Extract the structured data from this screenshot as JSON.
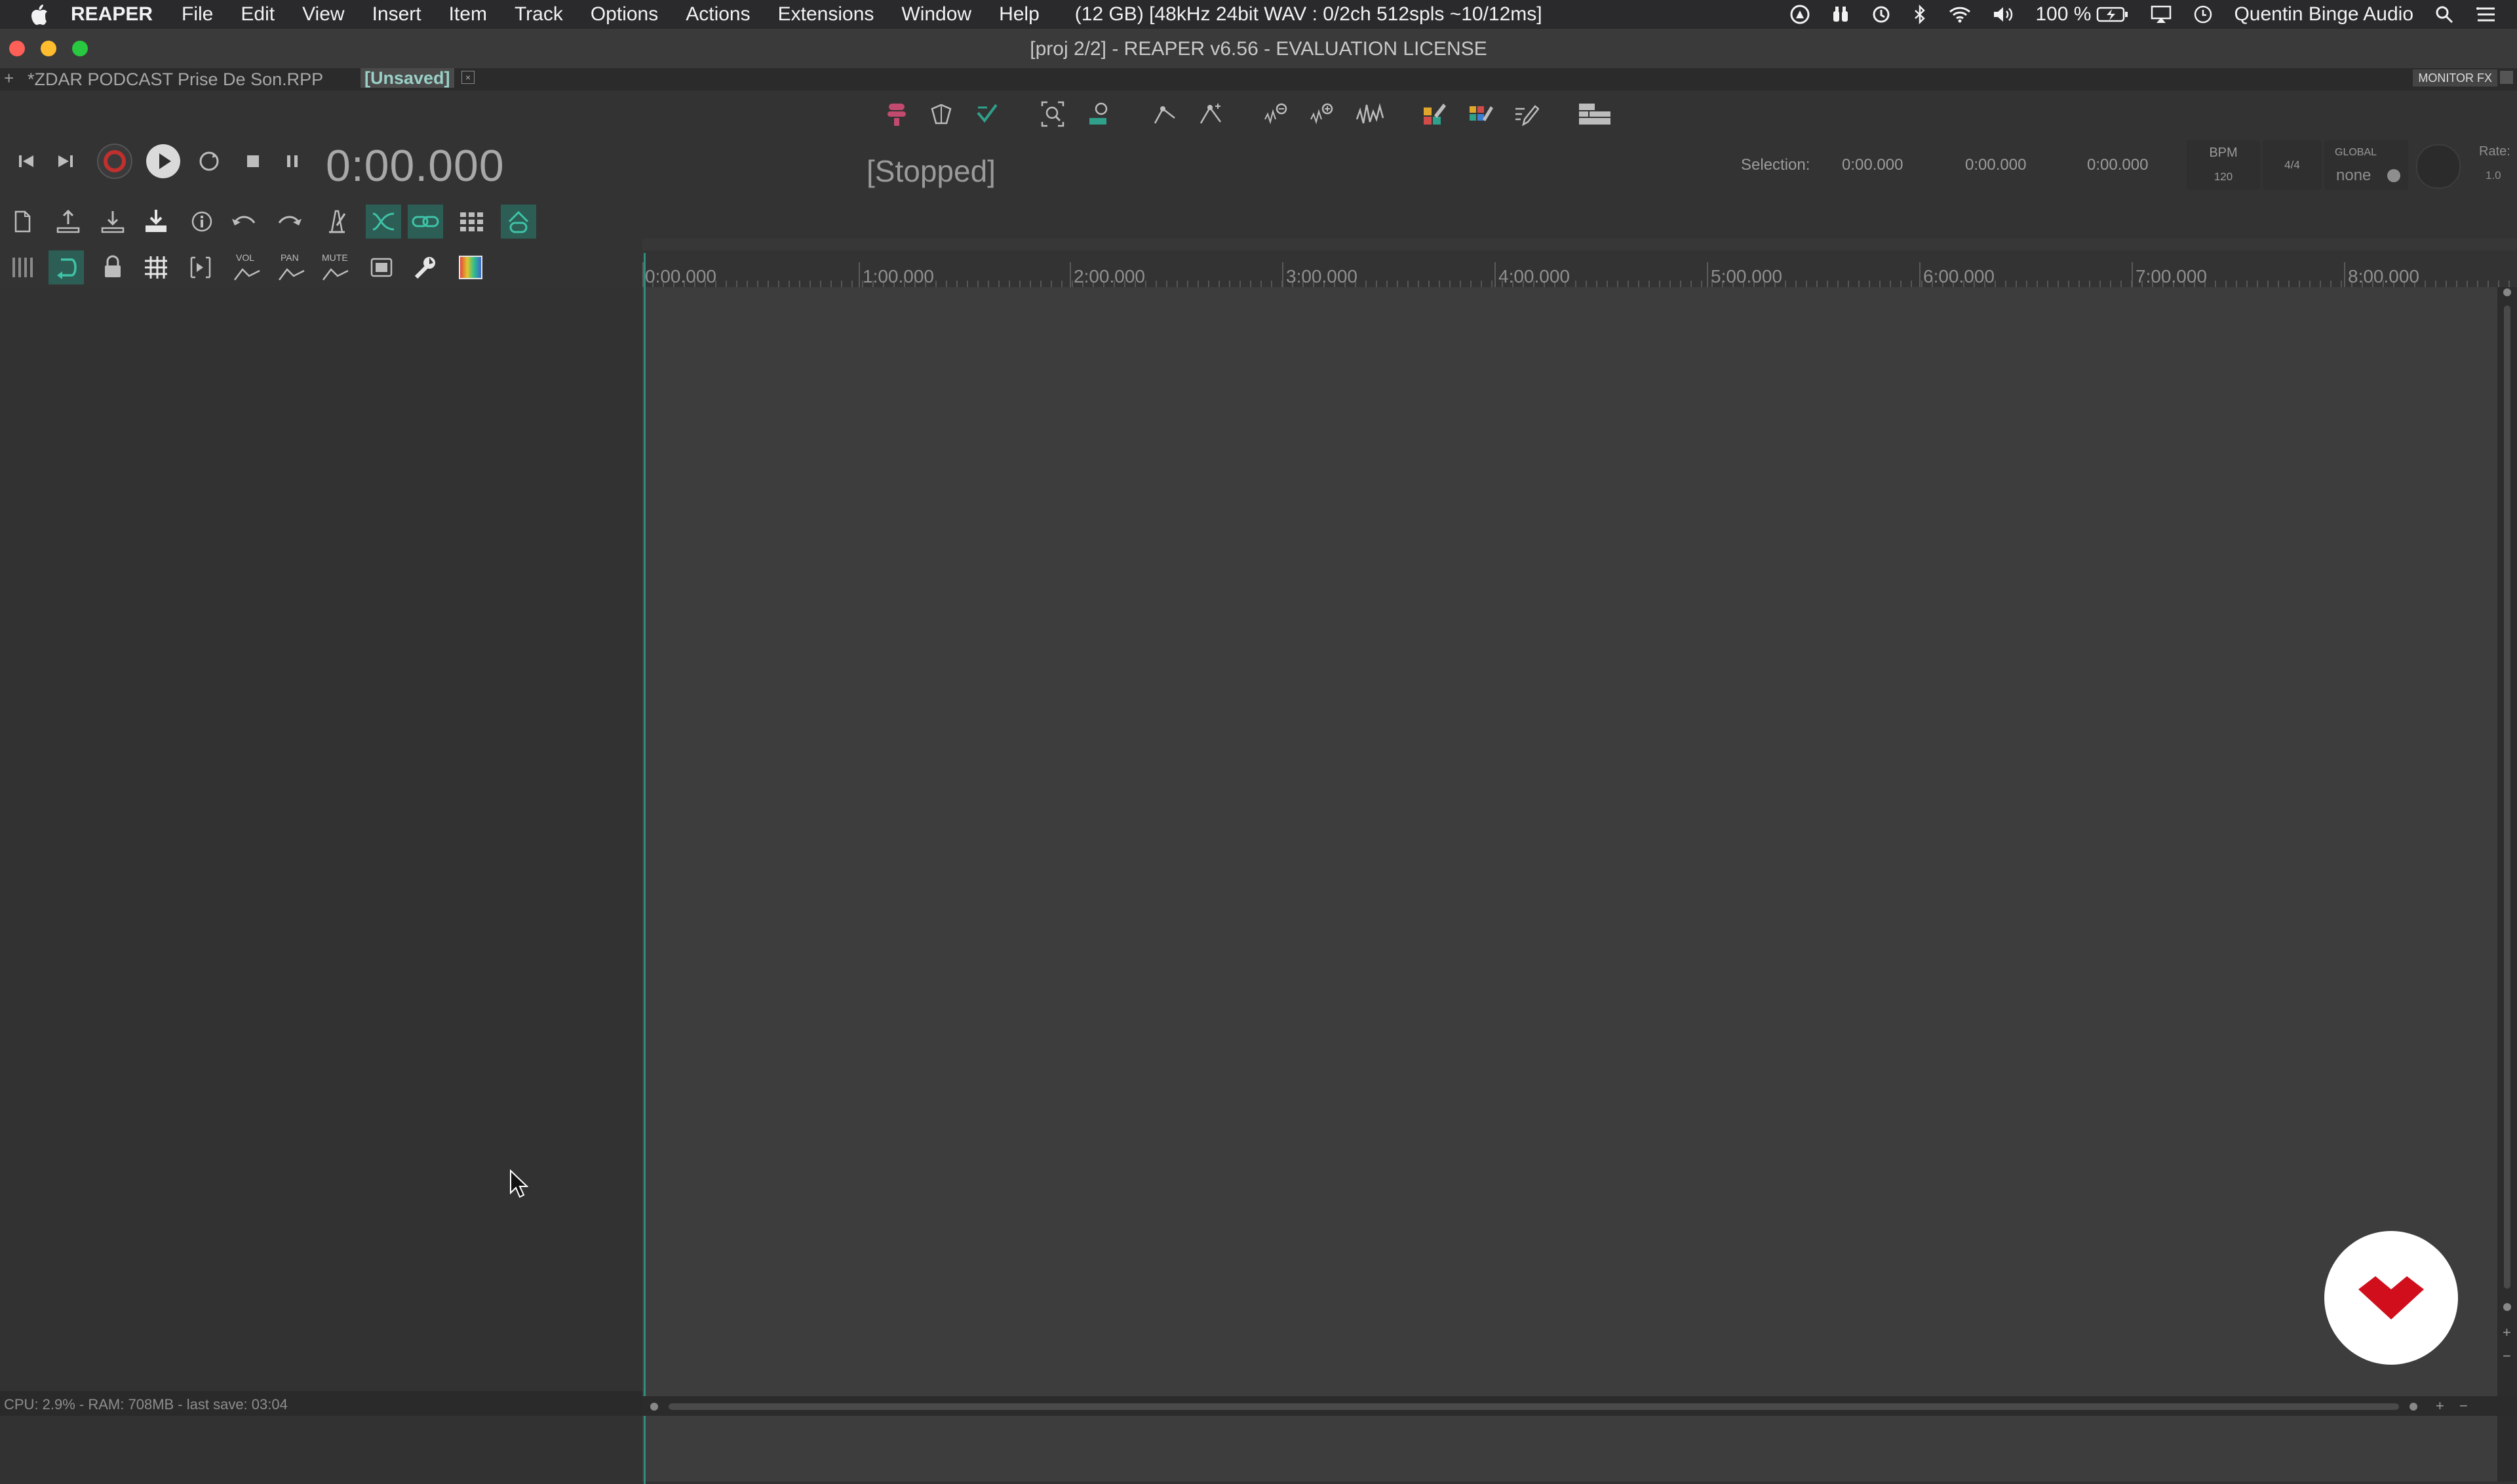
{
  "menubar": {
    "app_name": "REAPER",
    "items": [
      "File",
      "Edit",
      "View",
      "Insert",
      "Item",
      "Track",
      "Options",
      "Actions",
      "Extensions",
      "Window",
      "Help"
    ],
    "status_text": "(12 GB) [48kHz 24bit WAV : 0/2ch 512spls ~10/12ms]",
    "battery": "100 %",
    "user": "Quentin Binge Audio"
  },
  "window": {
    "title": "[proj 2/2] - REAPER v6.56 - EVALUATION LICENSE"
  },
  "tabs": {
    "add": "+",
    "project1": "*ZDAR  PODCAST  Prise De Son.RPP",
    "project2": "[Unsaved]",
    "monitor_fx": "MONITOR FX"
  },
  "transport": {
    "time": "0:00.000",
    "state": "[Stopped]"
  },
  "selection": {
    "label": "Selection:",
    "start": "0:00.000",
    "end": "0:00.000",
    "length": "0:00.000"
  },
  "tempo": {
    "bpm_label": "BPM",
    "bpm": "120",
    "time_sig": "4/4",
    "global_label": "GLOBAL",
    "global_value": "none",
    "rate_label": "Rate:",
    "rate": "1.0"
  },
  "ruler": {
    "labels": [
      "0:00.000",
      "1:00.000",
      "2:00.000",
      "3:00.000",
      "4:00.000",
      "5:00.000",
      "6:00.000",
      "7:00.000",
      "8:00.000"
    ]
  },
  "tcp_toolbar": {
    "vol_label": "VOL",
    "pan_label": "PAN",
    "mute_label": "MUTE"
  },
  "status": {
    "text": "CPU: 2.9% - RAM: 708MB -  last save: 03:04"
  },
  "colors": {
    "accent": "#2f9c88",
    "record_red": "#c0302e",
    "logo_red": "#d10f1c"
  }
}
